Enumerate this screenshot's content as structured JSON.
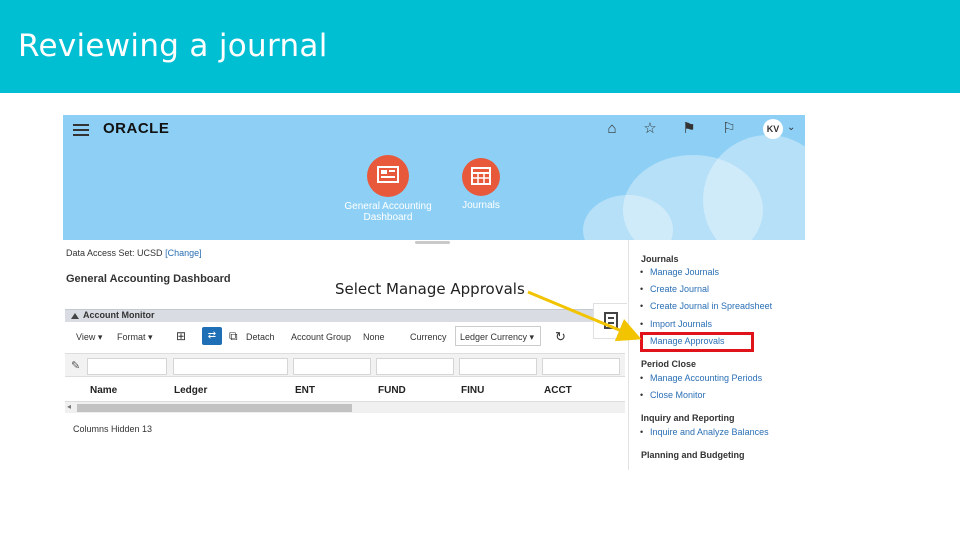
{
  "slide": {
    "title": "Reviewing a journal",
    "callout": "Select Manage Approvals"
  },
  "app": {
    "logo": "ORACLE",
    "avatar_initials": "KV",
    "header_icons": [
      "home-icon",
      "favorites-star-icon",
      "navigator-icon",
      "notifications-flag-icon"
    ],
    "tiles": [
      {
        "label_line1": "General Accounting",
        "label_line2": "Dashboard",
        "icon": "dashboard-icon"
      },
      {
        "label_line1": "Journals",
        "label_line2": "",
        "icon": "journal-table-icon"
      }
    ],
    "accent_colors": {
      "header": "#8ed0f5",
      "tile": "#e8593c",
      "title_bar": "#00bfd3",
      "highlight": "#e0131b",
      "arrow": "#f2c400"
    }
  },
  "page": {
    "data_access_set_label": "Data Access Set: UCSD",
    "change_link": "[Change]",
    "title": "General Accounting Dashboard",
    "account_monitor": "Account Monitor",
    "toolbar": {
      "view": "View",
      "format": "Format",
      "detach": "Detach",
      "account_group_label": "Account Group",
      "account_group_value": "None",
      "currency_label": "Currency",
      "currency_value": "Ledger Currency"
    },
    "columns": [
      "Name",
      "Ledger",
      "ENT",
      "FUND",
      "FINU",
      "ACCT"
    ],
    "columns_hidden": "Columns Hidden  13"
  },
  "tasks": {
    "journals_head": "Journals",
    "journals": [
      "Manage Journals",
      "Create Journal",
      "Create Journal in Spreadsheet",
      "Import Journals",
      "Manage Approvals"
    ],
    "period_close_head": "Period Close",
    "period_close": [
      "Manage Accounting Periods",
      "Close Monitor"
    ],
    "inquiry_head": "Inquiry and Reporting",
    "inquiry": [
      "Inquire and Analyze Balances"
    ],
    "planning_head": "Planning and Budgeting"
  }
}
